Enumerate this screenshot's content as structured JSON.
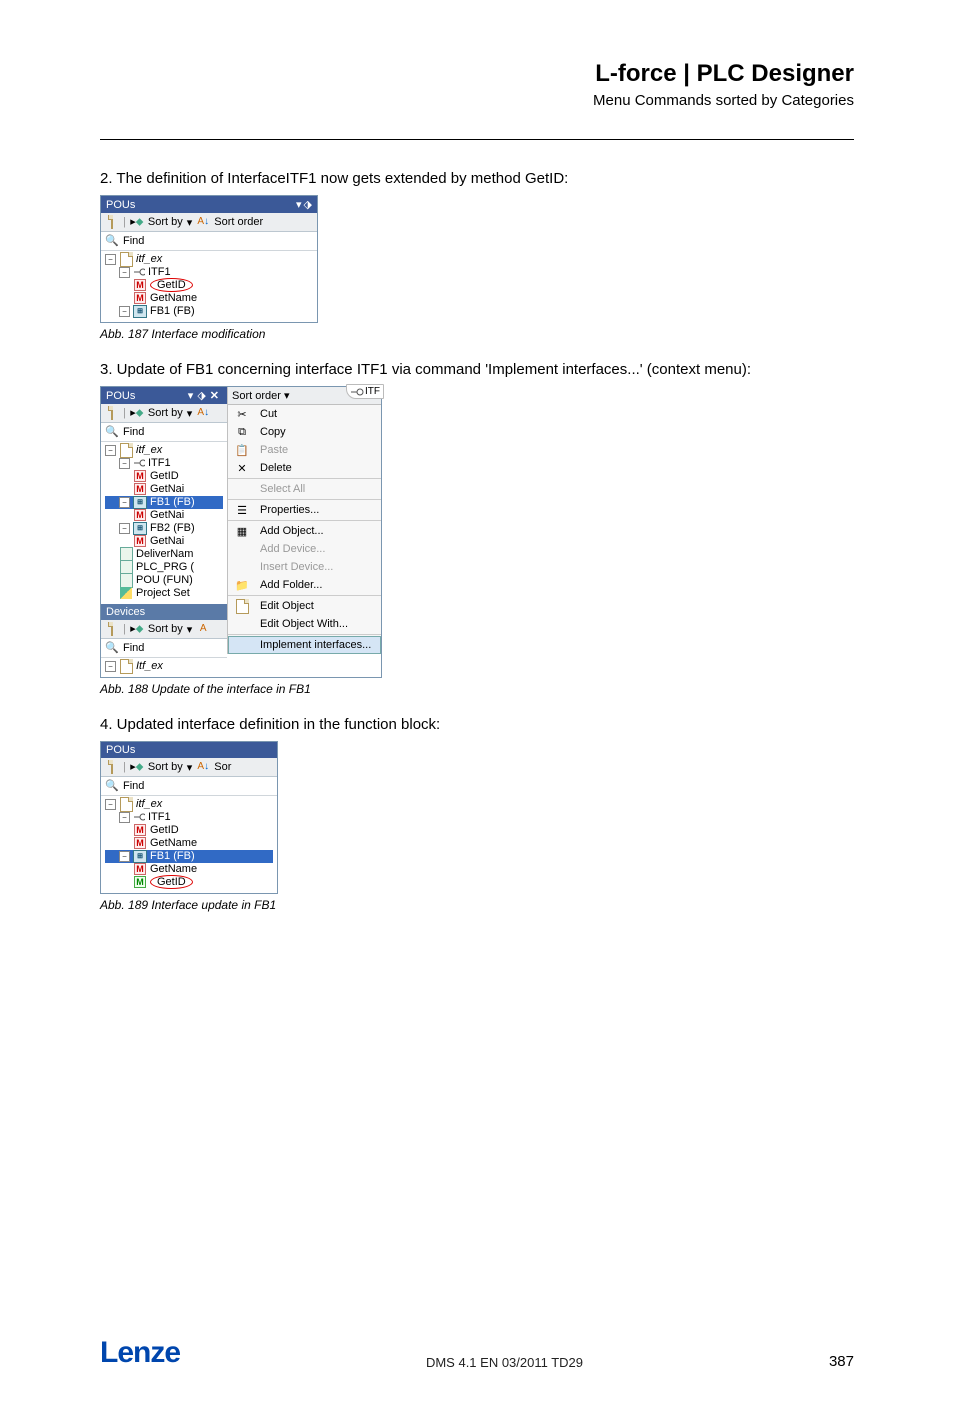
{
  "header": {
    "title": "L-force | PLC Designer",
    "subtitle": "Menu Commands sorted by Categories"
  },
  "step2": "2. The definition of InterfaceITF1 now gets extended by method GetID:",
  "caption187": "Abb. 187     Interface modification",
  "step3": "3. Update of FB1 concerning interface ITF1 via command 'Implement interfaces...' (context menu):",
  "caption188": "Abb. 188     Update of the interface in FB1",
  "step4": "4. Updated interface definition in the function block:",
  "caption189": "Abb. 189     Interface update in FB1",
  "panel": {
    "title": "POUs",
    "toolbar": {
      "sortby": "Sort by",
      "sortorder": "Sort order",
      "sort_short": "Sort order",
      "sor": "Sor"
    },
    "find": "Find"
  },
  "panel1": {
    "tree": {
      "root": "itf_ex",
      "itf1": "ITF1",
      "getid": "GetID",
      "getname": "GetName",
      "fb1": "FB1 (FB)"
    }
  },
  "panel2": {
    "left_tree": {
      "root": "itf_ex",
      "itf1": "ITF1",
      "getid": "GetID",
      "getna": "GetNai",
      "fb1": "FB1 (FB)",
      "fb1_getna": "GetNai",
      "fb2": "FB2 (FB)",
      "fb2_getna": "GetNai",
      "delivernam": "DeliverNam",
      "plc_prg": "PLC_PRG (",
      "pou_fun": "POU (FUN)",
      "project_set": "Project Set"
    },
    "devices_title": "Devices",
    "devices_tree": {
      "root": "Itf_ex"
    },
    "itf_tab": "ITF",
    "ctx": {
      "cut": "Cut",
      "copy": "Copy",
      "paste": "Paste",
      "delete": "Delete",
      "selectall": "Select All",
      "properties": "Properties...",
      "addobject": "Add Object...",
      "adddevice": "Add Device...",
      "insertdevice": "Insert Device...",
      "addfolder": "Add Folder...",
      "editobject": "Edit Object",
      "editobjectwith": "Edit Object With...",
      "implementinterfaces": "Implement interfaces..."
    }
  },
  "panel3": {
    "tree": {
      "root": "itf_ex",
      "itf1": "ITF1",
      "getid": "GetID",
      "getname": "GetName",
      "fb1": "FB1 (FB)",
      "fb1_getname": "GetName",
      "fb1_getid": "GetID"
    }
  },
  "footer": {
    "brand": "Lenze",
    "mid": "DMS 4.1 EN 03/2011 TD29",
    "page": "387"
  }
}
